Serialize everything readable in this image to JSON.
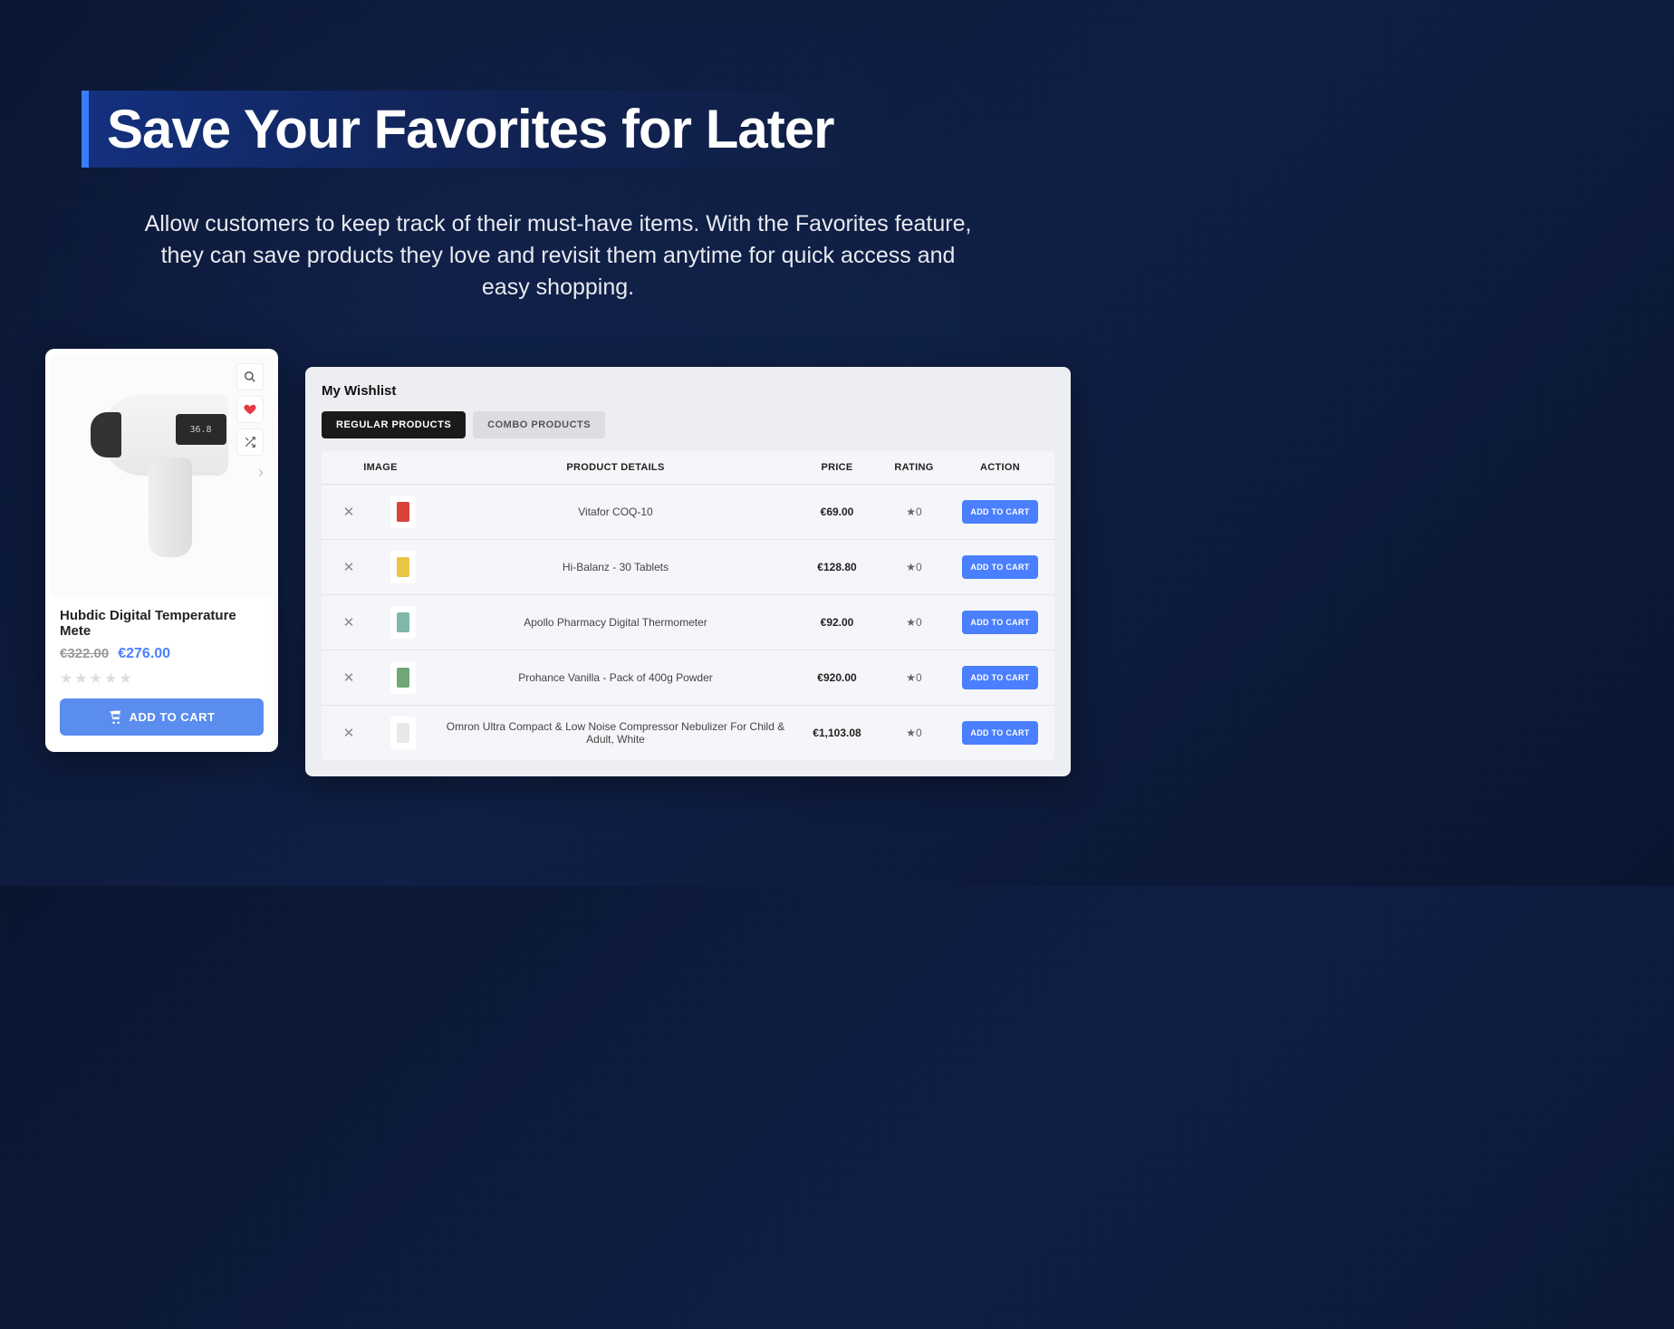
{
  "hero": {
    "title": "Save Your Favorites for Later",
    "description": "Allow customers to keep track of their must-have items. With the Favorites feature, they can save products they love and revisit them anytime for quick access and easy shopping."
  },
  "product_card": {
    "title": "Hubdic Digital Temperature Mete",
    "old_price": "€322.00",
    "new_price": "€276.00",
    "screen_readout": "36.8",
    "add_to_cart_label": "ADD TO CART"
  },
  "wishlist": {
    "title": "My Wishlist",
    "tabs": {
      "regular": "REGULAR PRODUCTS",
      "combo": "COMBO PRODUCTS"
    },
    "columns": {
      "image": "IMAGE",
      "details": "PRODUCT DETAILS",
      "price": "PRICE",
      "rating": "RATING",
      "action": "ACTION"
    },
    "action_label": "ADD TO CART",
    "items": [
      {
        "name": "Vitafor COQ-10",
        "price": "€69.00",
        "rating": "★0",
        "color": "#d9433a"
      },
      {
        "name": "Hi-Balanz - 30 Tablets",
        "price": "€128.80",
        "rating": "★0",
        "color": "#e8c547"
      },
      {
        "name": "Apollo Pharmacy Digital Thermometer",
        "price": "€92.00",
        "rating": "★0",
        "color": "#7fb8a8"
      },
      {
        "name": "Prohance Vanilla - Pack of 400g Powder",
        "price": "€920.00",
        "rating": "★0",
        "color": "#6fa876"
      },
      {
        "name": "Omron Ultra Compact & Low Noise Compressor Nebulizer For Child & Adult, White",
        "price": "€1,103.08",
        "rating": "★0",
        "color": "#e8e8e8"
      }
    ]
  }
}
